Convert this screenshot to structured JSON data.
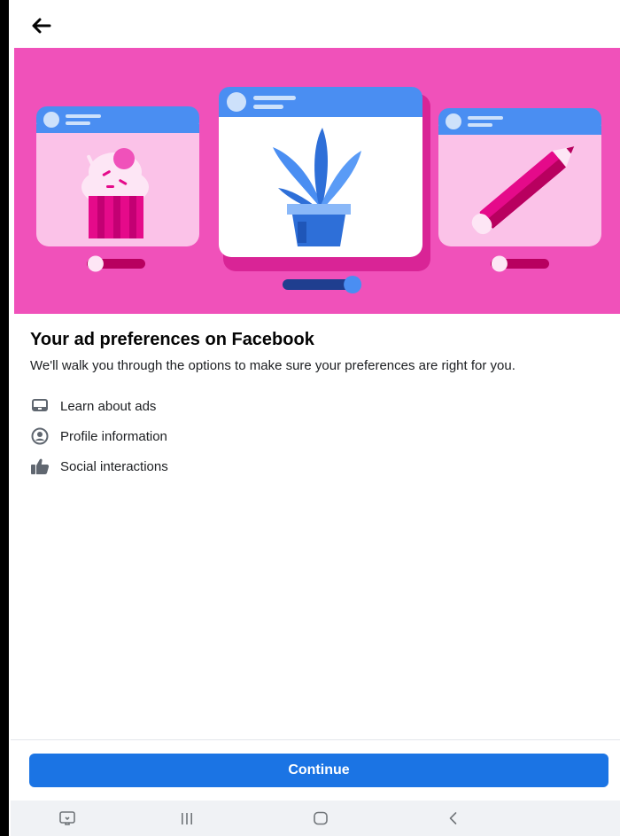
{
  "header": {
    "back_icon": "arrow-left-icon"
  },
  "hero": {
    "colors": {
      "background": "#f051ba",
      "blue": "#4a8ef2",
      "pink": "#e50a8a"
    },
    "slider_levels": [
      0.15,
      0.92,
      0.15
    ]
  },
  "main": {
    "title": "Your ad preferences on Facebook",
    "description": "We'll walk you through the options to make sure your preferences are right for you.",
    "items": [
      {
        "icon": "laptop-icon",
        "label": "Learn about ads"
      },
      {
        "icon": "profile-circle-icon",
        "label": "Profile information"
      },
      {
        "icon": "thumbs-up-icon",
        "label": "Social interactions"
      }
    ]
  },
  "footer": {
    "continue_label": "Continue",
    "button_color": "#1b74e4"
  },
  "system_nav": {
    "icons": [
      "screen-icon",
      "recent-apps-icon",
      "home-icon",
      "back-icon"
    ]
  }
}
